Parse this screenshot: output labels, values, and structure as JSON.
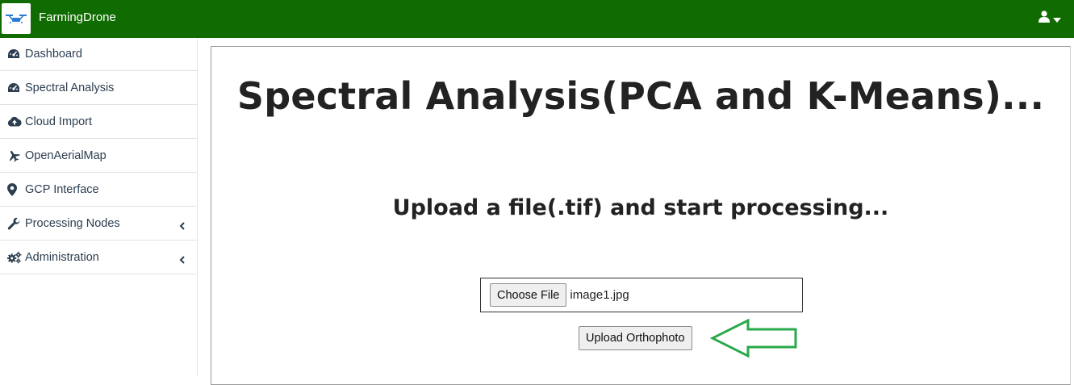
{
  "navbar": {
    "brand": "FarmingDrone",
    "logo_icon": "drone-logo-icon",
    "user_icon": "user-icon",
    "caret_icon": "caret-down-icon",
    "background": "#106c00"
  },
  "sidebar": {
    "items": [
      {
        "label": "Dashboard",
        "icon": "dashboard-gauge-icon"
      },
      {
        "label": "Spectral Analysis",
        "icon": "dashboard-gauge-icon"
      },
      {
        "label": "Cloud Import",
        "icon": "cloud-upload-icon"
      },
      {
        "label": "OpenAerialMap",
        "icon": "plane-icon"
      },
      {
        "label": "GCP Interface",
        "icon": "map-marker-icon"
      },
      {
        "label": "Processing Nodes",
        "icon": "wrench-icon",
        "has_submenu": true
      },
      {
        "label": "Administration",
        "icon": "gears-icon",
        "has_submenu": true
      }
    ]
  },
  "main": {
    "title": "Spectral Analysis(PCA and K-Means)...",
    "subtitle": "Upload a file(.tif) and start processing...",
    "file_input": {
      "button_label": "Choose File",
      "file_name": "image1.jpg"
    },
    "upload_button_label": "Upload Orthophoto",
    "annotation": {
      "icon": "arrow-left-outline-icon",
      "color": "#2aa84a"
    }
  }
}
